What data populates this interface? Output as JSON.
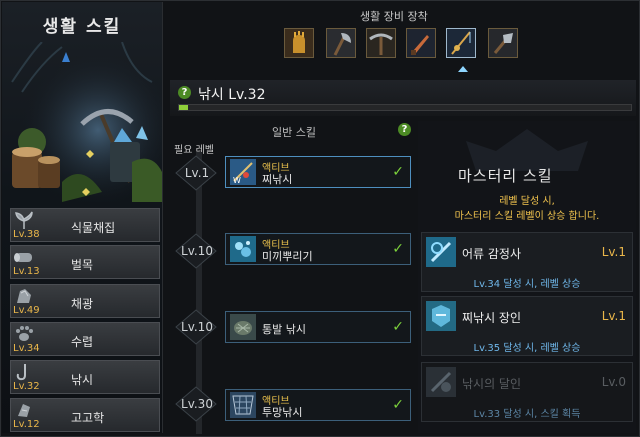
{
  "left_panel": {
    "title": "생활 스킬",
    "skills": [
      {
        "icon": "sprout-icon",
        "level": "Lv.38",
        "name": "식물채집"
      },
      {
        "icon": "log-icon",
        "level": "Lv.13",
        "name": "벌목"
      },
      {
        "icon": "ore-icon",
        "level": "Lv.49",
        "name": "채광"
      },
      {
        "icon": "paw-icon",
        "level": "Lv.34",
        "name": "수렵"
      },
      {
        "icon": "fishhook-icon",
        "level": "Lv.32",
        "name": "낚시"
      },
      {
        "icon": "relic-icon",
        "level": "Lv.12",
        "name": "고고학"
      }
    ]
  },
  "equip": {
    "title": "생활 장비 장착",
    "slots": [
      "glove-icon",
      "axe-icon",
      "pickaxe-icon",
      "knife-icon",
      "fishing-rod-icon",
      "shovel-icon"
    ],
    "selected_index": 4
  },
  "skill_header": {
    "badge": "?",
    "title": "낚시 Lv.32",
    "xp_fraction": 0.02
  },
  "general": {
    "title": "일반 스킬",
    "badge": "?",
    "required_level_label": "필요 레벨",
    "rows": [
      {
        "level": "Lv.1",
        "type": "액티브",
        "name": "찌낚시",
        "icon": "float-fishing-icon",
        "done": true
      },
      {
        "level": "Lv.10",
        "type": "액티브",
        "name": "미끼뿌리기",
        "icon": "bait-icon",
        "done": true
      },
      {
        "level": "Lv.10",
        "type": "",
        "name": "통발 낚시",
        "icon": "trap-icon",
        "done": true
      },
      {
        "level": "Lv.30",
        "type": "액티브",
        "name": "투망낚시",
        "icon": "net-icon",
        "done": true
      }
    ],
    "check_glyph": "✓"
  },
  "master": {
    "title": "마스터리 스킬",
    "desc_line1": "레벨 달성 시,",
    "desc_line2": "마스터리 스킬 레벨이 상승 합니다.",
    "skills": [
      {
        "icon": "appraiser-icon",
        "name": "어류 감정사",
        "level": "Lv.1",
        "condition": "Lv.34 달성 시, 레벨 상승",
        "active": true
      },
      {
        "icon": "artisan-icon",
        "name": "찌낚시 장인",
        "level": "Lv.1",
        "condition": "Lv.35 달성 시, 레벨 상승",
        "active": true
      },
      {
        "icon": "master-icon",
        "name": "낚시의 달인",
        "level": "Lv.0",
        "condition": "Lv.33 달성 시, 스킬 획득",
        "active": false
      }
    ]
  },
  "colors": {
    "accent_gold": "#e9b64a",
    "check_green": "#7cd13b",
    "condition_blue": "#6fb7ea",
    "xp_green": "#8fcf3a"
  }
}
